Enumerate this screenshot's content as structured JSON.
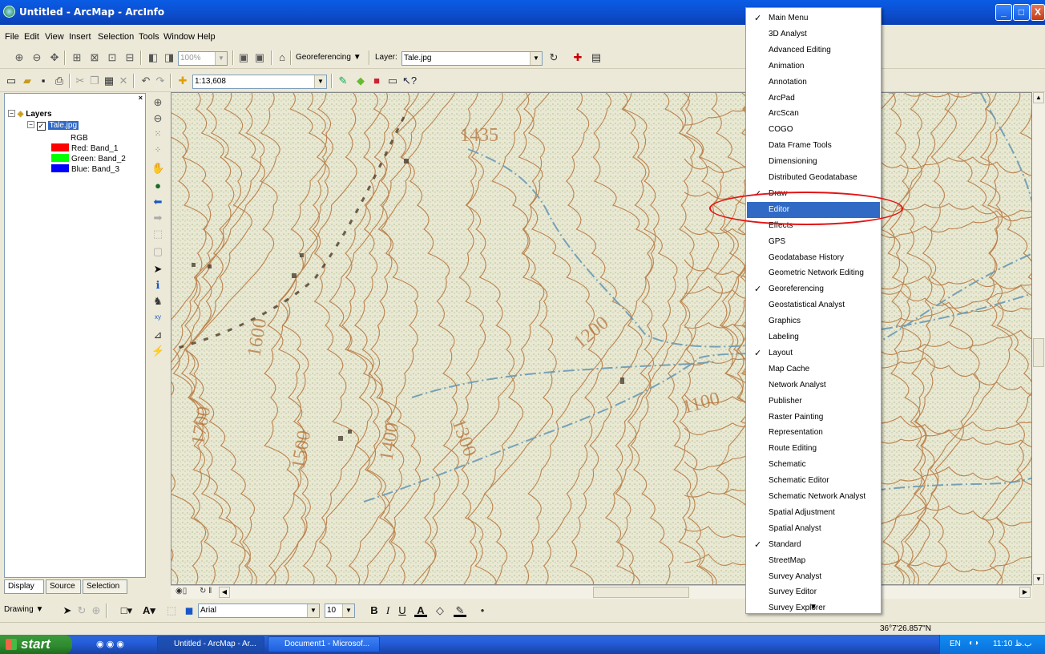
{
  "window": {
    "title": "Untitled - ArcMap - ArcInfo",
    "minimize": "_",
    "maximize": "□",
    "close": "X"
  },
  "menu": [
    "File",
    "Edit",
    "View",
    "Insert",
    "Selection",
    "Tools",
    "Window",
    "Help"
  ],
  "toolbar1": {
    "zoom_value": "100%",
    "georef_label": "Georeferencing ▼",
    "layer_label": "Layer:",
    "layer_value": "Tale.jpg"
  },
  "toolbar2": {
    "scale_value": "1:13,608"
  },
  "toc": {
    "root": "Layers",
    "layer": "Tale.jpg",
    "rgb": "RGB",
    "bands": [
      {
        "label": "Red:  Band_1",
        "color": "#FF0000"
      },
      {
        "label": "Green: Band_2",
        "color": "#00FF00"
      },
      {
        "label": "Blue:  Band_3",
        "color": "#0000FF"
      }
    ],
    "tabs": [
      "Display",
      "Source",
      "Selection"
    ]
  },
  "map": {
    "contour_labels": [
      "1435",
      "1600",
      "1500",
      "1400",
      "1700",
      "1300",
      "1200",
      "1100"
    ]
  },
  "drawing_toolbar": {
    "drawing_label": "Drawing ▼",
    "font_name": "Arial",
    "font_size": "10",
    "bold": "B",
    "italic": "I",
    "underline": "U"
  },
  "status": {
    "coordinates": "36°7'26.857\"N"
  },
  "taskbar": {
    "start": "start",
    "tasks": [
      "Untitled - ArcMap - Ar...",
      "Document1 - Microsof..."
    ],
    "lang": "EN",
    "time": "11:10 ب.ظ"
  },
  "dropdown": {
    "items": [
      {
        "label": "Main Menu",
        "checked": true
      },
      {
        "label": "3D Analyst",
        "checked": false
      },
      {
        "label": "Advanced Editing",
        "checked": false
      },
      {
        "label": "Animation",
        "checked": false
      },
      {
        "label": "Annotation",
        "checked": false
      },
      {
        "label": "ArcPad",
        "checked": false
      },
      {
        "label": "ArcScan",
        "checked": false
      },
      {
        "label": "COGO",
        "checked": false
      },
      {
        "label": "Data Frame Tools",
        "checked": false
      },
      {
        "label": "Dimensioning",
        "checked": false
      },
      {
        "label": "Distributed Geodatabase",
        "checked": false
      },
      {
        "label": "Draw",
        "checked": true
      },
      {
        "label": "Editor",
        "checked": false,
        "selected": true
      },
      {
        "label": "Effects",
        "checked": false
      },
      {
        "label": "GPS",
        "checked": false
      },
      {
        "label": "Geodatabase History",
        "checked": false
      },
      {
        "label": "Geometric Network Editing",
        "checked": false
      },
      {
        "label": "Georeferencing",
        "checked": true
      },
      {
        "label": "Geostatistical Analyst",
        "checked": false
      },
      {
        "label": "Graphics",
        "checked": false
      },
      {
        "label": "Labeling",
        "checked": false
      },
      {
        "label": "Layout",
        "checked": true
      },
      {
        "label": "Map Cache",
        "checked": false
      },
      {
        "label": "Network Analyst",
        "checked": false
      },
      {
        "label": "Publisher",
        "checked": false
      },
      {
        "label": "Raster Painting",
        "checked": false
      },
      {
        "label": "Representation",
        "checked": false
      },
      {
        "label": "Route Editing",
        "checked": false
      },
      {
        "label": "Schematic",
        "checked": false
      },
      {
        "label": "Schematic Editor",
        "checked": false
      },
      {
        "label": "Schematic Network Analyst",
        "checked": false
      },
      {
        "label": "Spatial Adjustment",
        "checked": false
      },
      {
        "label": "Spatial Analyst",
        "checked": false
      },
      {
        "label": "Standard",
        "checked": true
      },
      {
        "label": "StreetMap",
        "checked": false
      },
      {
        "label": "Survey Analyst",
        "checked": false
      },
      {
        "label": "Survey Editor",
        "checked": false
      },
      {
        "label": "Survey Explorer",
        "checked": false
      }
    ],
    "more_arrow": "▼"
  },
  "colors": {
    "selection": "#316AC5",
    "highlight_ring": "#E21414",
    "contour": "#B5733A",
    "stream": "#6A9AB5"
  }
}
